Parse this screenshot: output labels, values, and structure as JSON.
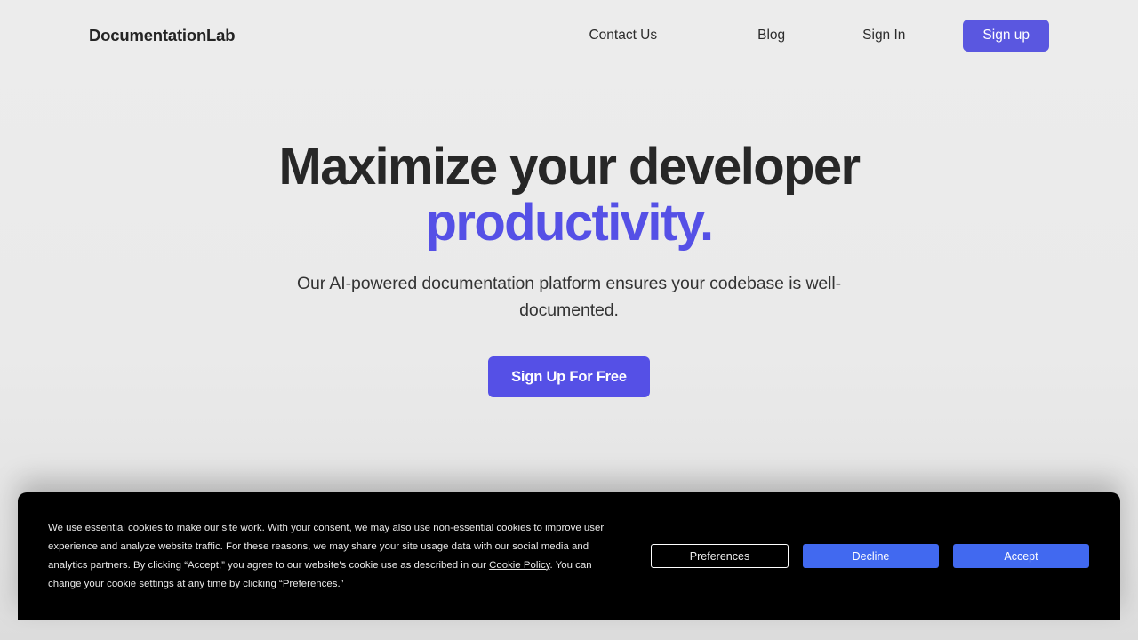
{
  "header": {
    "brand": "DocumentationLab",
    "nav": [
      {
        "label": "Contact Us",
        "name": "nav-contact-us"
      },
      {
        "label": "Blog",
        "name": "nav-blog"
      },
      {
        "label": "Sign In",
        "name": "nav-sign-in"
      }
    ],
    "signup_label": "Sign up"
  },
  "hero": {
    "title_line1": "Maximize your developer",
    "title_accent": "productivity.",
    "subtitle": "Our AI-powered documentation platform ensures your codebase is well-documented.",
    "cta_label": "Sign Up For Free"
  },
  "cookie_banner": {
    "text_part1": "We use essential cookies to make our site work. With your consent, we may also use non-essential cookies to improve user experience and analyze website traffic. For these reasons, we may share your site usage data with our social media and analytics partners. By clicking “Accept,” you agree to our website's cookie use as described in our ",
    "link_cookie_policy": "Cookie Policy",
    "text_part2": ". You can change your cookie settings at any time by clicking “",
    "link_preferences": "Preferences",
    "text_part3": ".”",
    "buttons": {
      "preferences": "Preferences",
      "decline": "Decline",
      "accept": "Accept"
    }
  },
  "colors": {
    "accent_indigo": "#5550e6",
    "header_button": "#5a57e0",
    "banner_button_blue": "#4169f0",
    "banner_background": "#000000",
    "page_background": "#eaeaea",
    "heading_text": "#272727"
  }
}
